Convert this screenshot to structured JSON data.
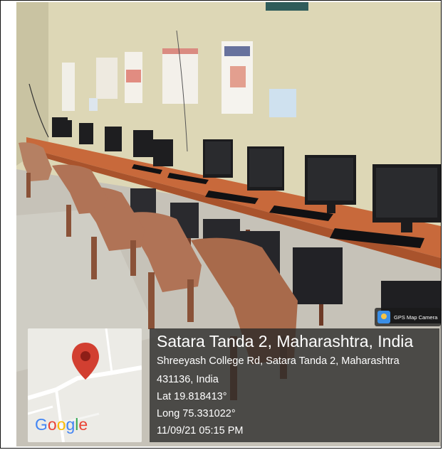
{
  "overlay": {
    "badge_label": "GPS Map Camera",
    "location_title": "Satara Tanda 2, Maharashtra, India",
    "address_line1": "Shreeyash College Rd, Satara Tanda 2, Maharashtra",
    "address_line2": "431136, India",
    "latitude": "Lat 19.818413°",
    "longitude": "Long 75.331022°",
    "timestamp": "11/09/21 05:15 PM"
  },
  "map_card": {
    "logo_letters": [
      "G",
      "o",
      "o",
      "g",
      "l",
      "e"
    ],
    "logo_colors": [
      "#4285F4",
      "#EA4335",
      "#FBBC05",
      "#4285F4",
      "#34A853",
      "#EA4335"
    ],
    "pin_color": "#d23f31",
    "pin_icon": "map-pin-icon"
  },
  "colors": {
    "wall": "#ddd7b6",
    "desk": "#c86a3c",
    "chair": "#a7694a",
    "floor": "#c2bdb3"
  }
}
